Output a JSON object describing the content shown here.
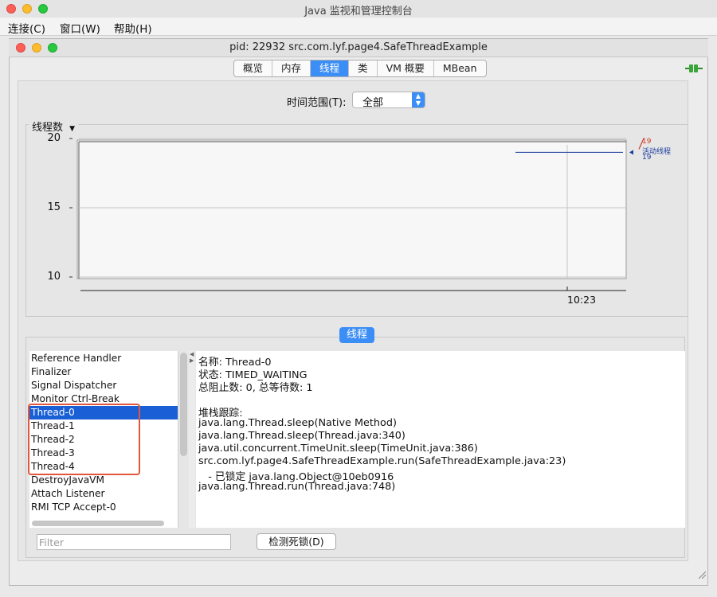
{
  "app": {
    "window_title": "Java 监视和管理控制台",
    "menu": [
      "连接(C)",
      "窗口(W)",
      "帮助(H)"
    ]
  },
  "inner_window": {
    "title": "pid: 22932 src.com.lyf.page4.SafeThreadExample"
  },
  "tabs": [
    {
      "label": "概览",
      "active": false
    },
    {
      "label": "内存",
      "active": false
    },
    {
      "label": "线程",
      "active": true
    },
    {
      "label": "类",
      "active": false
    },
    {
      "label": "VM 概要",
      "active": false
    },
    {
      "label": "MBean",
      "active": false
    }
  ],
  "time_range": {
    "label": "时间范围(T):",
    "value": "全部"
  },
  "chart_data": {
    "type": "line",
    "title": "线程数",
    "yticks": [
      "20",
      "15",
      "10"
    ],
    "ylim": [
      10,
      20
    ],
    "xticks": [
      "10:23"
    ],
    "series": [
      {
        "name": "活动线程",
        "values": [
          19
        ],
        "color": "#1a3d9e"
      }
    ],
    "peak_value": "19",
    "peak_color": "#d03a2b",
    "current_value": "19",
    "grid": true
  },
  "threads_section": {
    "button_label": "线程",
    "list": [
      "Reference Handler",
      "Finalizer",
      "Signal Dispatcher",
      "Monitor Ctrl-Break",
      "Thread-0",
      "Thread-1",
      "Thread-2",
      "Thread-3",
      "Thread-4",
      "DestroyJavaVM",
      "Attach Listener",
      "RMI TCP Accept-0"
    ],
    "selected": "Thread-0",
    "detail": {
      "name_line": "名称: Thread-0",
      "state_line": "状态: TIMED_WAITING",
      "counts_line": "总阻止数: 0, 总等待数: 1",
      "stack_header": "堆栈跟踪:",
      "stack": [
        "java.lang.Thread.sleep(Native Method)",
        "java.lang.Thread.sleep(Thread.java:340)",
        "java.util.concurrent.TimeUnit.sleep(TimeUnit.java:386)",
        "src.com.lyf.page4.SafeThreadExample.run(SafeThreadExample.java:23)",
        "   - 已锁定 java.lang.Object@10eb0916",
        "java.lang.Thread.run(Thread.java:748)"
      ]
    },
    "filter_placeholder": "Filter",
    "detect_button": "检测死锁(D)"
  },
  "icons": {
    "connection": "connection-plug-icon",
    "dropdown": "chevron-down-icon"
  }
}
